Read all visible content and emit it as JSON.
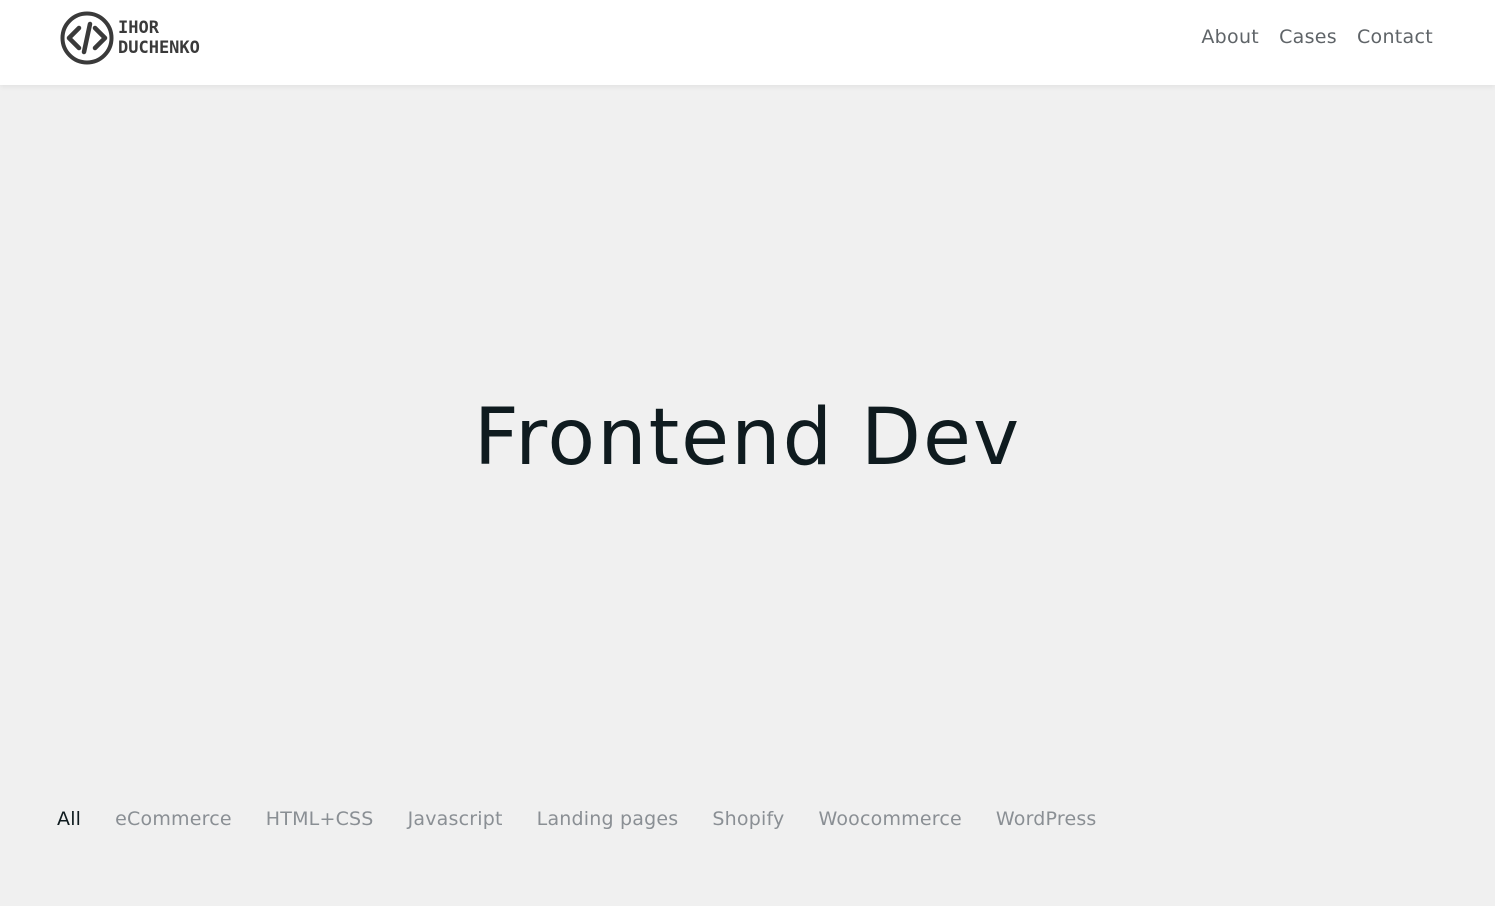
{
  "header": {
    "logo": {
      "line1": "IHOR",
      "line2": "DUCHENKO",
      "icon": "code-brackets-icon"
    },
    "nav": [
      {
        "label": "About"
      },
      {
        "label": "Cases"
      },
      {
        "label": "Contact"
      }
    ]
  },
  "hero": {
    "title": "Frontend Dev"
  },
  "filters": {
    "items": [
      {
        "label": "All",
        "active": true
      },
      {
        "label": "eCommerce",
        "active": false
      },
      {
        "label": "HTML+CSS",
        "active": false
      },
      {
        "label": "Javascript",
        "active": false
      },
      {
        "label": "Landing pages",
        "active": false
      },
      {
        "label": "Shopify",
        "active": false
      },
      {
        "label": "Woocommerce",
        "active": false
      },
      {
        "label": "WordPress",
        "active": false
      }
    ]
  },
  "colors": {
    "background": "#f0f0f0",
    "header_bg": "#ffffff",
    "text_dark": "#0f1b1f",
    "text_muted": "#8a8f94",
    "nav_text": "#5f6468",
    "logo": "#3a3a3a"
  }
}
